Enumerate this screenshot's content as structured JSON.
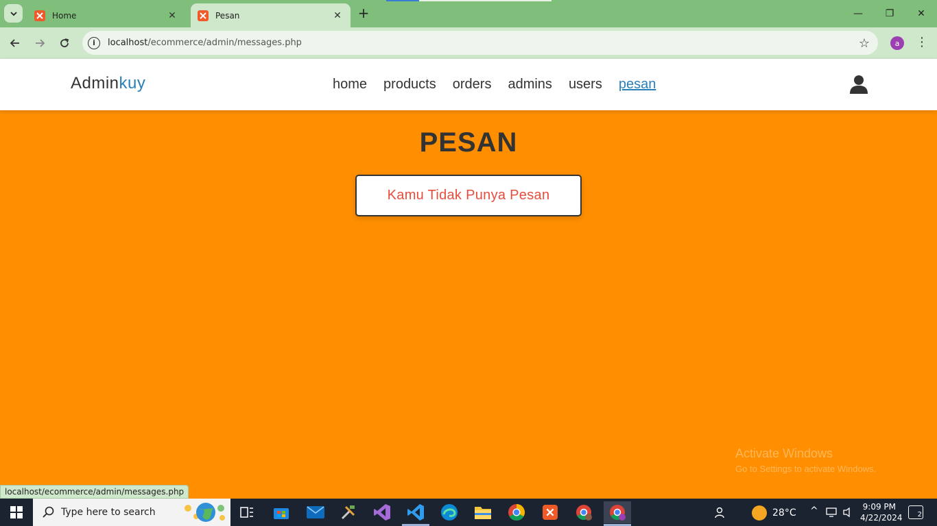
{
  "browser": {
    "tabs": [
      {
        "title": "Home",
        "active": false
      },
      {
        "title": "Pesan",
        "active": true
      }
    ],
    "address": {
      "host": "localhost",
      "path": "/ecommerce/admin/messages.php"
    },
    "profile_initial": "a",
    "status_url": "localhost/ecommerce/admin/messages.php",
    "colors": {
      "chrome": "#7fbf7b",
      "toolbar": "#cfe7cb",
      "favicon": "#f05a28"
    }
  },
  "header": {
    "logo_main": "Admin",
    "logo_accent": "kuy",
    "nav": [
      {
        "label": "home",
        "active": false
      },
      {
        "label": "products",
        "active": false
      },
      {
        "label": "orders",
        "active": false
      },
      {
        "label": "admins",
        "active": false
      },
      {
        "label": "users",
        "active": false
      },
      {
        "label": "pesan",
        "active": true
      }
    ],
    "colors": {
      "accent": "#2980b9",
      "text": "#333333"
    }
  },
  "main": {
    "heading": "PESAN",
    "empty_message": "Kamu Tidak Punya Pesan",
    "colors": {
      "background": "#ff8f00",
      "empty_text": "#e74c3c"
    }
  },
  "watermark": {
    "line1": "Activate Windows",
    "line2": "Go to Settings to activate Windows."
  },
  "taskbar": {
    "search_placeholder": "Type here to search",
    "weather": "28°C",
    "time": "9:09 PM",
    "date": "4/22/2024",
    "notification_count": "2"
  }
}
